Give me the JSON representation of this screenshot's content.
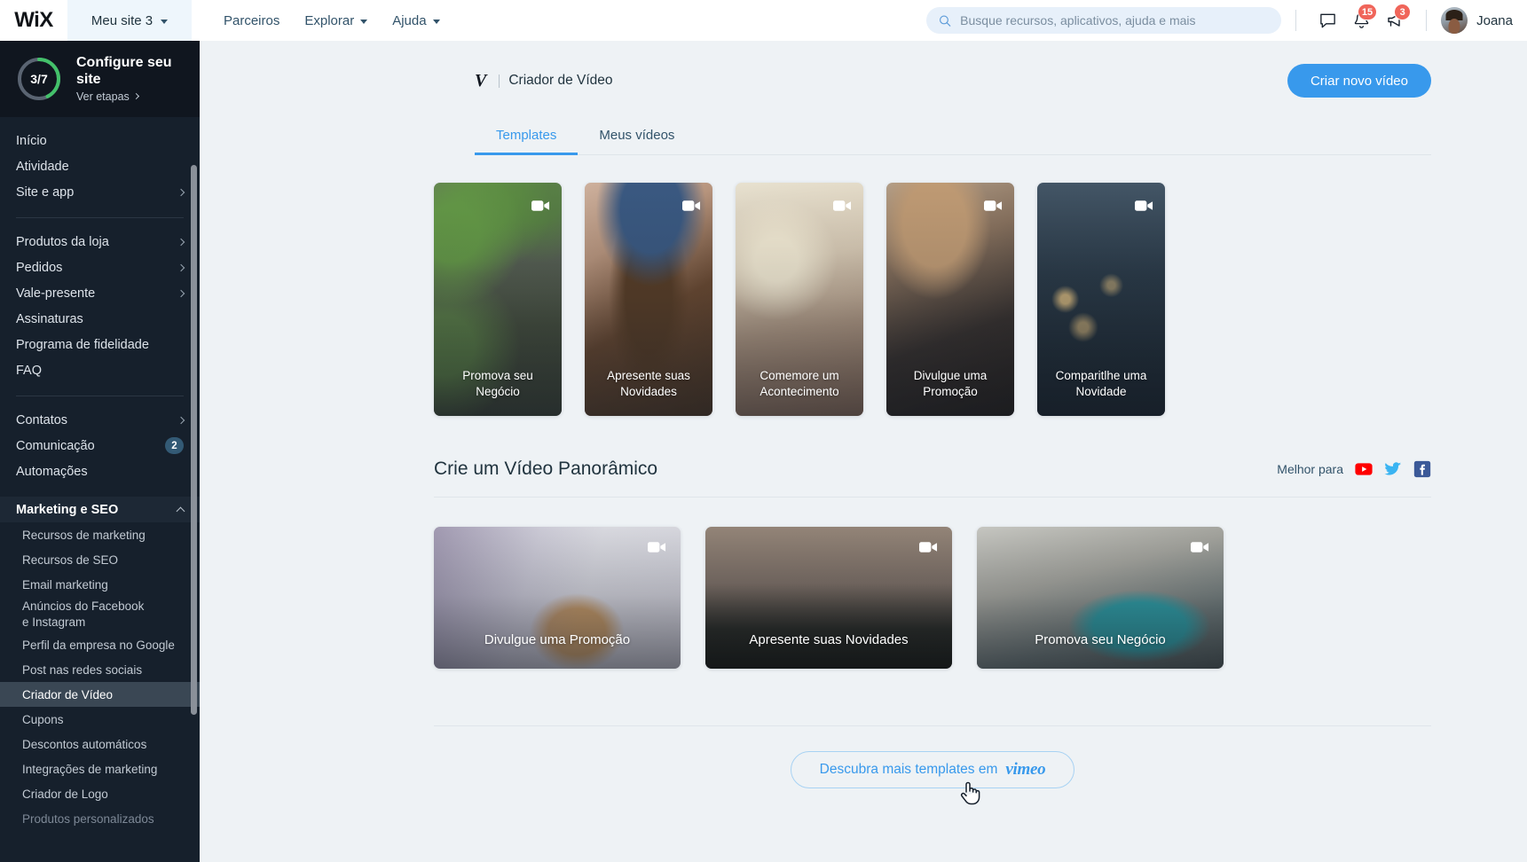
{
  "topbar": {
    "logo_text": "WiX",
    "site_switcher": {
      "label": "Meu site 3"
    },
    "nav": [
      {
        "label": "Parceiros",
        "has_caret": false
      },
      {
        "label": "Explorar",
        "has_caret": true
      },
      {
        "label": "Ajuda",
        "has_caret": true
      }
    ],
    "search": {
      "placeholder": "Busque recursos, aplicativos, ajuda e mais",
      "value": ""
    },
    "icons": [
      {
        "name": "chat-icon",
        "badge": ""
      },
      {
        "name": "bell-icon",
        "badge": "15"
      },
      {
        "name": "megaphone-icon",
        "badge": "3"
      }
    ],
    "user": {
      "name": "Joana"
    },
    "badge_color": "#f0655a"
  },
  "sidebar": {
    "setup": {
      "progress_label": "3/7",
      "title": "Configure seu site",
      "link_label": "Ver etapas",
      "progress_value": 3,
      "progress_total": 7,
      "ring_color": "#43c16a",
      "track_color": "#5a6472"
    },
    "group1": [
      {
        "label": "Início",
        "chevron": false
      },
      {
        "label": "Atividade",
        "chevron": false
      },
      {
        "label": "Site e app",
        "chevron": true
      }
    ],
    "group2": [
      {
        "label": "Produtos da loja",
        "chevron": true
      },
      {
        "label": "Pedidos",
        "chevron": true
      },
      {
        "label": "Vale-presente",
        "chevron": true
      },
      {
        "label": "Assinaturas",
        "chevron": false
      },
      {
        "label": "Programa de fidelidade",
        "chevron": false
      },
      {
        "label": "FAQ",
        "chevron": false
      }
    ],
    "group3": [
      {
        "label": "Contatos",
        "chevron": true,
        "badge": ""
      },
      {
        "label": "Comunicação",
        "chevron": false,
        "badge": "2"
      },
      {
        "label": "Automações",
        "chevron": false,
        "badge": ""
      }
    ],
    "marketing": {
      "label": "Marketing e SEO",
      "expanded": true
    },
    "marketing_items": [
      {
        "label": "Recursos de marketing",
        "active": false,
        "dim": false
      },
      {
        "label": "Recursos de SEO",
        "active": false,
        "dim": false
      },
      {
        "label": "Email marketing",
        "active": false,
        "dim": false
      },
      {
        "label": "Anúncios do Facebook",
        "label2": "e Instagram",
        "active": false,
        "dim": false,
        "two_line": true
      },
      {
        "label": "Perfil da empresa no Google",
        "active": false,
        "dim": false
      },
      {
        "label": "Post nas redes sociais",
        "active": false,
        "dim": false
      },
      {
        "label": "Criador de Vídeo",
        "active": true,
        "dim": false
      },
      {
        "label": "Cupons",
        "active": false,
        "dim": false
      },
      {
        "label": "Descontos automáticos",
        "active": false,
        "dim": false
      },
      {
        "label": "Integrações de marketing",
        "active": false,
        "dim": false
      },
      {
        "label": "Criador de Logo",
        "active": false,
        "dim": false
      },
      {
        "label": "Produtos personalizados",
        "active": false,
        "dim": true
      }
    ]
  },
  "main": {
    "header": {
      "brand_mark": "V",
      "title": "Criador de Vídeo",
      "primary_button": "Criar novo vídeo"
    },
    "tabs": [
      {
        "label": "Templates",
        "active": true
      },
      {
        "label": "Meus vídeos",
        "active": false
      }
    ],
    "templates": [
      {
        "title": "Promova seu Negócio",
        "line1": "Promova seu",
        "line2": "Negócio",
        "photo": "ph-yoga"
      },
      {
        "title": "Apresente suas Novidades",
        "line1": "Apresente suas",
        "line2": "Novidades",
        "photo": "ph-hair"
      },
      {
        "title": "Comemore um Acontecimento",
        "line1": "Comemore um",
        "line2": "Acontecimento",
        "photo": "ph-jump"
      },
      {
        "title": "Divulgue uma Promoção",
        "line1": "Divulgue uma",
        "line2": "Promoção",
        "photo": "ph-shop"
      },
      {
        "title": "Comparitlhe uma Novidade",
        "line1": "Comparitlhe uma",
        "line2": "Novidade",
        "photo": "ph-lights"
      }
    ],
    "panoramic": {
      "title": "Crie um Vídeo Panorâmico",
      "best_for_label": "Melhor para",
      "socials": [
        {
          "name": "youtube-icon",
          "color": "#ff0000"
        },
        {
          "name": "twitter-icon",
          "color": "#3ab4f2"
        },
        {
          "name": "facebook-icon",
          "color": "#3b5998"
        }
      ],
      "cards": [
        {
          "title": "Divulgue uma Promoção",
          "photo": "ph-laptop"
        },
        {
          "title": "Apresente suas Novidades",
          "photo": "ph-crowd"
        },
        {
          "title": "Promova seu Negócio",
          "photo": "ph-mat"
        }
      ]
    },
    "footer": {
      "discover_label": "Descubra mais templates em",
      "vimeo_wordmark": "vimeo"
    }
  }
}
